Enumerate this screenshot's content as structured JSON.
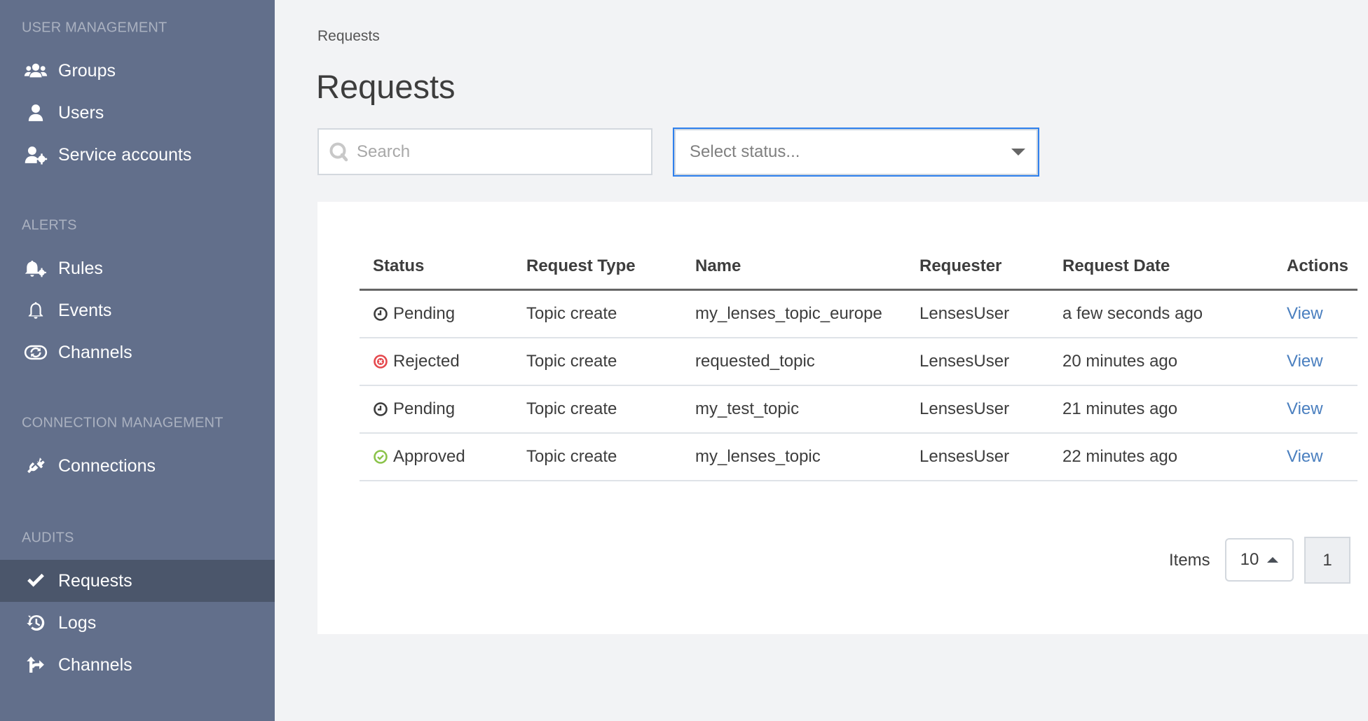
{
  "sidebar": {
    "sections": [
      {
        "title": "USER MANAGEMENT",
        "items": [
          {
            "label": "Groups",
            "icon": "users-group-icon"
          },
          {
            "label": "Users",
            "icon": "user-icon"
          },
          {
            "label": "Service accounts",
            "icon": "user-cog-icon"
          }
        ]
      },
      {
        "title": "ALERTS",
        "items": [
          {
            "label": "Rules",
            "icon": "bell-cog-icon"
          },
          {
            "label": "Events",
            "icon": "bell-outline-icon"
          },
          {
            "label": "Channels",
            "icon": "sync-circle-icon"
          }
        ]
      },
      {
        "title": "CONNECTION MANAGEMENT",
        "items": [
          {
            "label": "Connections",
            "icon": "plug-disconnected-icon"
          }
        ]
      },
      {
        "title": "AUDITS",
        "items": [
          {
            "label": "Requests",
            "icon": "check-icon",
            "active": true
          },
          {
            "label": "Logs",
            "icon": "history-icon"
          },
          {
            "label": "Channels",
            "icon": "route-arrows-icon"
          }
        ]
      }
    ]
  },
  "breadcrumb": "Requests",
  "page_title": "Requests",
  "search": {
    "placeholder": "Search",
    "value": ""
  },
  "status_filter": {
    "placeholder": "Select status..."
  },
  "table": {
    "columns": [
      "Status",
      "Request Type",
      "Name",
      "Requester",
      "Request Date",
      "Actions"
    ],
    "rows": [
      {
        "status": "Pending",
        "status_icon": "clock-icon",
        "type": "Topic create",
        "name": "my_lenses_topic_europe",
        "requester": "LensesUser",
        "date": "a few seconds ago",
        "action": "View"
      },
      {
        "status": "Rejected",
        "status_icon": "x-circle-icon",
        "type": "Topic create",
        "name": "requested_topic",
        "requester": "LensesUser",
        "date": "20 minutes ago",
        "action": "View"
      },
      {
        "status": "Pending",
        "status_icon": "clock-icon",
        "type": "Topic create",
        "name": "my_test_topic",
        "requester": "LensesUser",
        "date": "21 minutes ago",
        "action": "View"
      },
      {
        "status": "Approved",
        "status_icon": "check-circle-icon",
        "type": "Topic create",
        "name": "my_lenses_topic",
        "requester": "LensesUser",
        "date": "22 minutes ago",
        "action": "View"
      }
    ]
  },
  "pagination": {
    "items_label": "Items",
    "page_size": "10",
    "current_page": "1"
  },
  "colors": {
    "sidebar_bg": "#626f8b",
    "sidebar_active": "#4b566b",
    "link": "#4a7fbf",
    "rejected": "#e5484d",
    "approved": "#8bc34a",
    "focus_border": "#2f80ed"
  }
}
